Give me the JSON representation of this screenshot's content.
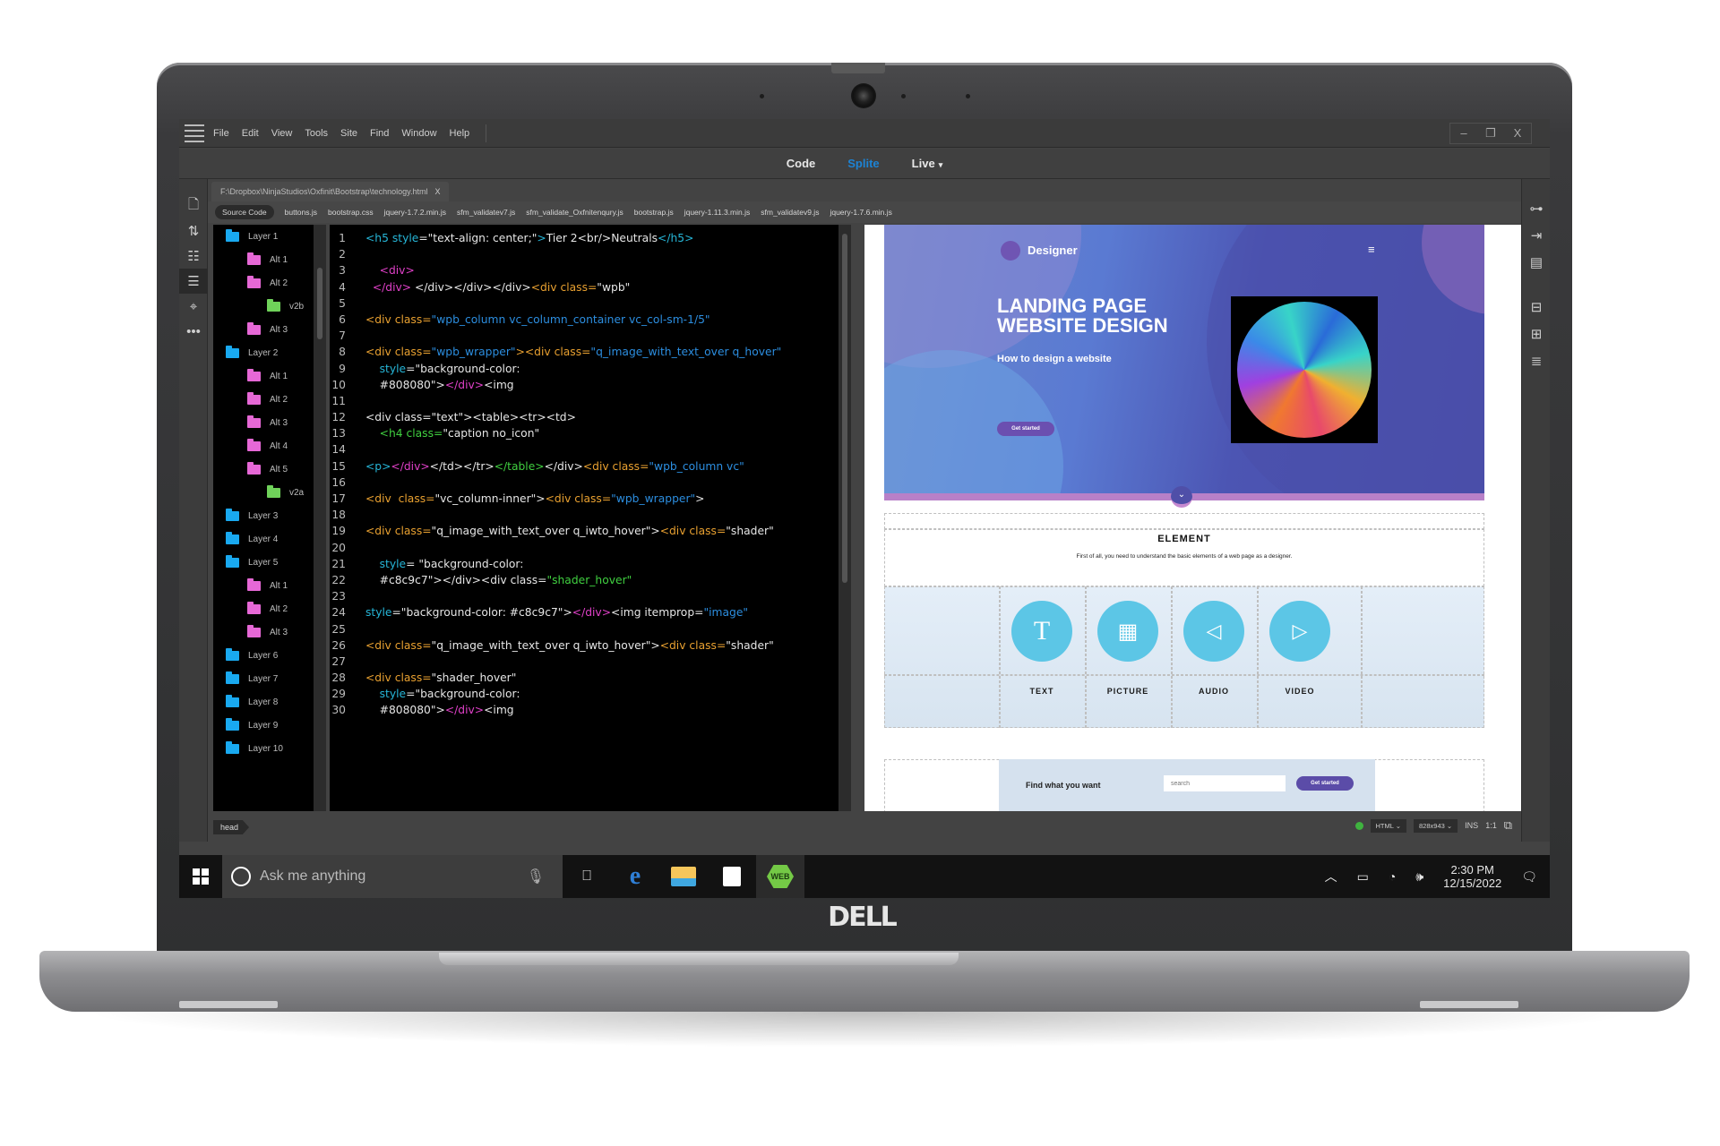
{
  "device": {
    "brand": "DELL"
  },
  "app": {
    "menu": [
      "File",
      "Edit",
      "View",
      "Tools",
      "Site",
      "Find",
      "Window",
      "Help"
    ],
    "window_controls": {
      "minimize": "–",
      "restore": "❐",
      "close": "X"
    },
    "view_modes": [
      {
        "label": "Code",
        "active": false
      },
      {
        "label": "Splite",
        "active": true
      },
      {
        "label": "Live",
        "active": false,
        "caret": "▾"
      }
    ],
    "document_tab": {
      "path": "F:\\Dropbox\\NinjaStudios\\Oxfinit\\Bootstrap\\technology.html",
      "close": "X"
    },
    "related_files": [
      "Source Code",
      "buttons.js",
      "bootstrap.css",
      "jquery-1.7.2.min.js",
      "sfm_validatev7.js",
      "sfm_validate_Oxfnitenqury.js",
      "bootstrap.js",
      "jquery-1.11.3.min.js",
      "sfm_validatev9.js",
      "jquery-1.7.6.min.js"
    ],
    "left_toolbar": [
      "file-icon",
      "sort-icon",
      "inspect-icon",
      "outline-icon",
      "target-icon",
      "more-icon"
    ],
    "right_toolbar": [
      "sitemap-icon",
      "import-icon",
      "chart-doc-icon",
      "tree-icon",
      "briefcase-icon",
      "code-snippet-icon"
    ],
    "layers": [
      {
        "label": "Layer 1",
        "level": 0,
        "color": "#19a9f0"
      },
      {
        "label": "Alt 1",
        "level": 1,
        "color": "#e668d6"
      },
      {
        "label": "Alt 2",
        "level": 1,
        "color": "#e668d6"
      },
      {
        "label": "v2b",
        "level": 2,
        "color": "#6fd25a"
      },
      {
        "label": "Alt 3",
        "level": 1,
        "color": "#e668d6"
      },
      {
        "label": "Layer 2",
        "level": 0,
        "color": "#19a9f0"
      },
      {
        "label": "Alt 1",
        "level": 1,
        "color": "#e668d6"
      },
      {
        "label": "Alt 2",
        "level": 1,
        "color": "#e668d6"
      },
      {
        "label": "Alt 3",
        "level": 1,
        "color": "#e668d6"
      },
      {
        "label": "Alt 4",
        "level": 1,
        "color": "#e668d6"
      },
      {
        "label": "Alt 5",
        "level": 1,
        "color": "#e668d6"
      },
      {
        "label": "v2a",
        "level": 2,
        "color": "#6fd25a"
      },
      {
        "label": "Layer 3",
        "level": 0,
        "color": "#19a9f0"
      },
      {
        "label": "Layer 4",
        "level": 0,
        "color": "#19a9f0"
      },
      {
        "label": "Layer 5",
        "level": 0,
        "color": "#19a9f0"
      },
      {
        "label": "Alt 1",
        "level": 1,
        "color": "#e668d6"
      },
      {
        "label": "Alt 2",
        "level": 1,
        "color": "#e668d6"
      },
      {
        "label": "Alt 3",
        "level": 1,
        "color": "#e668d6"
      },
      {
        "label": "Layer 6",
        "level": 0,
        "color": "#19a9f0"
      },
      {
        "label": "Layer 7",
        "level": 0,
        "color": "#19a9f0"
      },
      {
        "label": "Layer 8",
        "level": 0,
        "color": "#19a9f0"
      },
      {
        "label": "Layer 9",
        "level": 0,
        "color": "#19a9f0"
      },
      {
        "label": "Layer 10",
        "level": 0,
        "color": "#19a9f0"
      }
    ],
    "code_lines": [
      [
        [
          "c",
          "<h5 "
        ],
        [
          "c",
          "style"
        ],
        [
          "w",
          "=\"text-align: center;\""
        ],
        [
          "c",
          ">"
        ],
        [
          "w",
          "Tier 2<br/>Neutrals"
        ],
        [
          "c",
          "</h5>"
        ]
      ],
      [],
      [
        [
          "w",
          "    "
        ],
        [
          "m",
          "<div>"
        ]
      ],
      [
        [
          "w",
          "  "
        ],
        [
          "m",
          "</div>"
        ],
        [
          "w",
          " </div></div></div>"
        ],
        [
          "o",
          "<div class="
        ],
        [
          "w",
          "\"wpb\""
        ]
      ],
      [],
      [
        [
          "o",
          "<div class="
        ],
        [
          "b",
          "\"wpb_column vc_column_container vc_col-sm-1/5\""
        ]
      ],
      [],
      [
        [
          "o",
          "<div class="
        ],
        [
          "b",
          "\"wpb_wrapper\""
        ],
        [
          "o",
          "><div class="
        ],
        [
          "b",
          "\"q_image_with_text_over q_hover\""
        ]
      ],
      [
        [
          "w",
          "    "
        ],
        [
          "c",
          "style"
        ],
        [
          "w",
          "=\"background-color:"
        ]
      ],
      [
        [
          "w",
          "    #808080\">"
        ],
        [
          "m",
          "</div>"
        ],
        [
          "w",
          "<img"
        ]
      ],
      [],
      [
        [
          "w",
          "<div class=\"text\"><table><tr><td>"
        ]
      ],
      [
        [
          "w",
          "    "
        ],
        [
          "g",
          "<h4 class="
        ],
        [
          "w",
          "\"caption no_icon\""
        ]
      ],
      [],
      [
        [
          "c",
          "<p>"
        ],
        [
          "m",
          "</div>"
        ],
        [
          "w",
          "</td></tr>"
        ],
        [
          "g",
          "</table>"
        ],
        [
          "w",
          "</div>"
        ],
        [
          "o",
          "<div class="
        ],
        [
          "b",
          "\"wpb_column vc\""
        ]
      ],
      [],
      [
        [
          "o",
          "<div  class="
        ],
        [
          "w",
          "\"vc_column-inner\">"
        ],
        [
          "o",
          "<div class="
        ],
        [
          "b",
          "\"wpb_wrapper\""
        ],
        [
          "w",
          ">"
        ]
      ],
      [],
      [
        [
          "o",
          "<div class="
        ],
        [
          "w",
          "\"q_image_with_text_over q_iwto_hover\">"
        ],
        [
          "o",
          "<div class="
        ],
        [
          "w",
          "\"shader\""
        ]
      ],
      [],
      [
        [
          "w",
          "    "
        ],
        [
          "c",
          "style"
        ],
        [
          "w",
          "= \"background-color:"
        ]
      ],
      [
        [
          "w",
          "    #c8c9c7\"></div><div class="
        ],
        [
          "g",
          "\"shader_hover\""
        ]
      ],
      [],
      [
        [
          "c",
          "style"
        ],
        [
          "w",
          "=\"background-color: #c8c9c7\">"
        ],
        [
          "m",
          "</div>"
        ],
        [
          "w",
          "<img itemprop="
        ],
        [
          "b",
          "\"image\""
        ]
      ],
      [],
      [
        [
          "o",
          "<div class="
        ],
        [
          "w",
          "\"q_image_with_text_over q_iwto_hover\">"
        ],
        [
          "o",
          "<div class="
        ],
        [
          "w",
          "\"shader\""
        ]
      ],
      [],
      [
        [
          "o",
          "<div class="
        ],
        [
          "w",
          "\"shader_hover\""
        ]
      ],
      [
        [
          "w",
          "    "
        ],
        [
          "c",
          "style"
        ],
        [
          "w",
          "=\"background-color:"
        ]
      ],
      [
        [
          "w",
          "    #808080\">"
        ],
        [
          "m",
          "</div>"
        ],
        [
          "w",
          "<img"
        ]
      ]
    ],
    "preview": {
      "brand": "Designer",
      "menu_icon": "≡",
      "title": "LANDING PAGE WEBSITE DESIGN",
      "subtitle": "How to design a website",
      "cta": "Get started",
      "scroll_icon": "⌄",
      "element_title": "ELEMENT",
      "element_desc": "First of all, you need to understand the basic elements of a web page as a designer.",
      "elements": [
        {
          "label": "TEXT",
          "icon": "T"
        },
        {
          "label": "PICTURE",
          "icon": "▦"
        },
        {
          "label": "AUDIO",
          "icon": "◁"
        },
        {
          "label": "VIDEO",
          "icon": "▷"
        }
      ],
      "find_label": "Find what you want",
      "search_placeholder": "search",
      "find_button": "Get started",
      "colors": {
        "hero": "#4c55b3",
        "accent_circle": "#5cc6e6",
        "button": "#5b4ca8"
      }
    },
    "status": {
      "tag": "head",
      "doc_type": "HTML",
      "dimensions": "828x943",
      "mode": "INS",
      "position": "1:1"
    }
  },
  "taskbar": {
    "search_placeholder": "Ask me anything",
    "pinned": [
      "task-view-icon",
      "edge-icon",
      "file-explorer-icon",
      "store-icon",
      "web-app-icon"
    ],
    "web_label": "WEB",
    "time": "2:30 PM",
    "date": "12/15/2022"
  }
}
